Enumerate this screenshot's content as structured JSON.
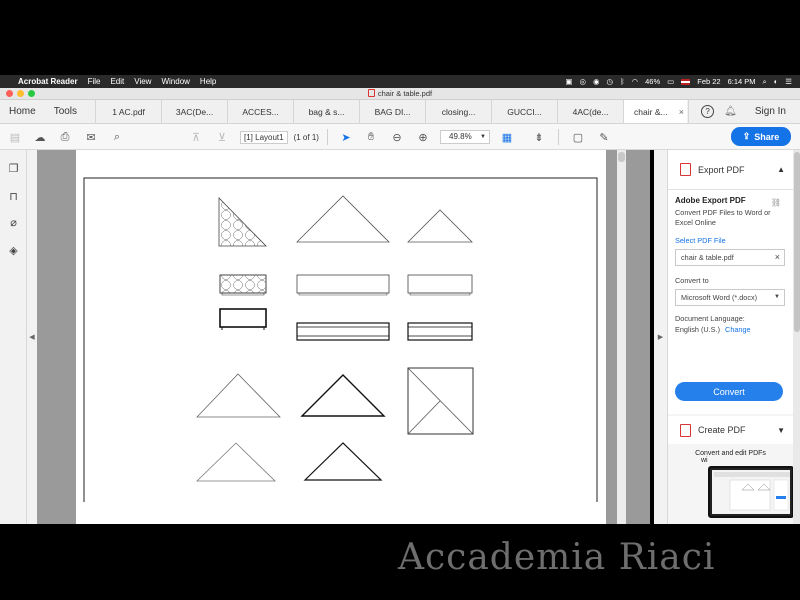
{
  "menubar": {
    "app": "Acrobat Reader",
    "items": [
      "File",
      "Edit",
      "View",
      "Window",
      "Help"
    ],
    "battery": "46%",
    "date": "Feb 22",
    "time": "6:14 PM"
  },
  "window": {
    "title": "chair & table.pdf"
  },
  "tabs": {
    "home": "Home",
    "tools": "Tools",
    "documents": [
      "1 AC.pdf",
      "3AC(De...",
      "ACCES...",
      "bag & s...",
      "BAG DI...",
      "closing...",
      "GUCCI...",
      "4AC(de..."
    ],
    "active": "chair &...",
    "help": "?",
    "signin": "Sign In"
  },
  "toolbar": {
    "page_field": "[1] Layout1",
    "page_count": "(1 of 1)",
    "zoom": "49.8%",
    "share": "Share"
  },
  "panel": {
    "export_title": "Export PDF",
    "adobe_export": "Adobe Export PDF",
    "description": "Convert PDF Files to Word or Excel Online",
    "select_file": "Select PDF File",
    "file_name": "chair & table.pdf",
    "convert_to_label": "Convert to",
    "convert_to_value": "Microsoft Word (*.docx)",
    "doc_language_label": "Document Language:",
    "doc_language_value": "English (U.S.)",
    "change": "Change",
    "convert_button": "Convert",
    "create_pdf": "Create PDF",
    "promo": "Convert and edit PDFs",
    "promo_line2": "wi"
  },
  "watermark": "Accademia Riaci"
}
